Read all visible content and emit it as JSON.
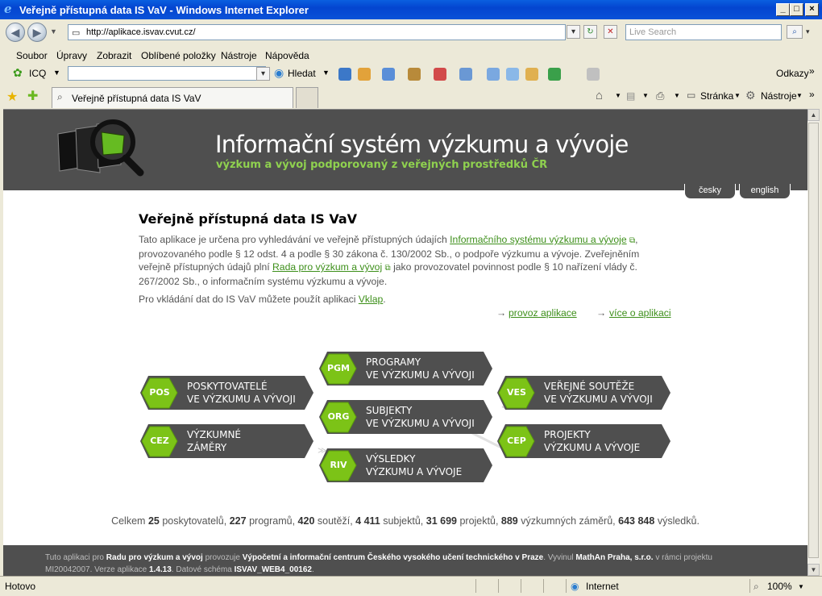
{
  "window": {
    "title": "Veřejně přístupná data IS VaV - Windows Internet Explorer"
  },
  "address": {
    "url": "http://aplikace.isvav.cvut.cz/",
    "search_placeholder": "Live Search"
  },
  "menu": [
    "Soubor",
    "Úpravy",
    "Zobrazit",
    "Oblíbené položky",
    "Nástroje",
    "Nápověda"
  ],
  "icqbar": {
    "icq_label": "ICQ",
    "search_label": "Hledat",
    "links_label": "Odkazy"
  },
  "tab": {
    "title": "Veřejně přístupná data IS VaV"
  },
  "cmdbar": {
    "page_label": "Stránka",
    "tools_label": "Nástroje"
  },
  "header": {
    "title": "Informační systém výzkumu a vývoje",
    "subtitle": "výzkum a vývoj podporovaný z veřejných prostředků ČR"
  },
  "lang": {
    "czech": "česky",
    "english": "english"
  },
  "intro": {
    "heading": "Veřejně přístupná data IS VaV",
    "p1_a": "Tato aplikace je určena pro vyhledávání ve veřejně přístupných údajích ",
    "p1_link1": "Informačního systému výzkumu a vývoje",
    "p1_b": ", provozovaného podle § 12 odst. 4 a podle § 30 zákona č. 130/2002 Sb., o podpoře výzkumu a vývoje. Zveřejněním veřejně přístupných údajů plní ",
    "p1_link2": "Rada pro výzkum a vývoj",
    "p1_c": " jako provozovatel povinnost podle § 10 nařízení vlády č. 267/2002 Sb., o informačním systému výzkumu a vývoje.",
    "p2_a": "Pro vkládání dat do IS VaV můžete použít aplikaci ",
    "p2_link": "Vklap",
    "p2_b": ".",
    "link_provoz": "provoz aplikace",
    "link_vice": "více o aplikaci"
  },
  "boxes": {
    "pgm": {
      "code": "PGM",
      "line1": "PROGRAMY",
      "line2": "VE VÝZKUMU A VÝVOJI"
    },
    "pos": {
      "code": "POS",
      "line1": "POSKYTOVATELÉ",
      "line2": "VE VÝZKUMU A VÝVOJI"
    },
    "ves": {
      "code": "VES",
      "line1": "VEŘEJNÉ SOUTĚŽE",
      "line2": "VE VÝZKUMU A VÝVOJI"
    },
    "org": {
      "code": "ORG",
      "line1": "SUBJEKTY",
      "line2": "VE VÝZKUMU A VÝVOJI"
    },
    "cez": {
      "code": "CEZ",
      "line1": "VÝZKUMNÉ",
      "line2": "ZÁMĚRY"
    },
    "cep": {
      "code": "CEP",
      "line1": "PROJEKTY",
      "line2": "VÝZKUMU A VÝVOJE"
    },
    "riv": {
      "code": "RIV",
      "line1": "VÝSLEDKY",
      "line2": "VÝZKUMU A VÝVOJE"
    }
  },
  "stats": {
    "prefix": "Celkem",
    "n1": "25",
    "t1": "poskytovatelů,",
    "n2": "227",
    "t2": "programů,",
    "n3": "420",
    "t3": "soutěží,",
    "n4": "4 411",
    "t4": "subjektů,",
    "n5": "31 699",
    "t5": "projektů,",
    "n6": "889",
    "t6": "výzkumných záměrů,",
    "n7": "643 848",
    "t7": "výsledků."
  },
  "footer": {
    "a": "Tuto aplikaci pro ",
    "b1": "Radu pro výzkum a vývoj",
    "c": " provozuje ",
    "b2": "Výpočetní a informační centrum Českého vysokého učení technického v Praze",
    "d": ". Vyvinul ",
    "b3": "MathAn Praha, s.r.o.",
    "e": " v rámci projektu MI20042007. Verze aplikace ",
    "b4": "1.4.13",
    "f": ". Datové schéma ",
    "b5": "ISVAV_WEB4_00162",
    "g": "."
  },
  "status": {
    "left": "Hotovo",
    "zone": "Internet",
    "zoom": "100%"
  },
  "colors": {
    "header_bg": "#4F4F4F",
    "accent_green": "#8FD14F",
    "link_green": "#3D8F1A"
  }
}
